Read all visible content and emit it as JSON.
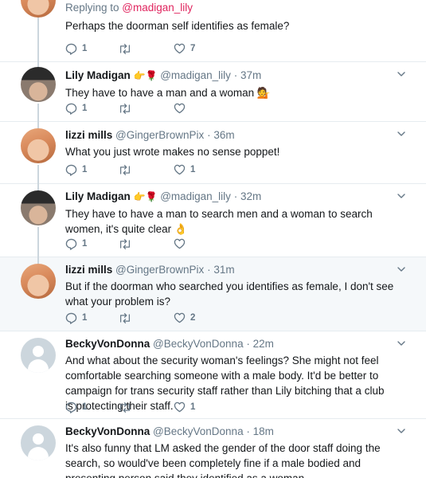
{
  "thread": {
    "replying_to_prefix": "Replying to ",
    "replying_to_handle": "@madigan_lily"
  },
  "tweets": [
    {
      "text": "Perhaps the doorman self identifies as female?",
      "replies": "1",
      "retweets": "",
      "likes": "7"
    },
    {
      "name": "Lily Madigan",
      "badges": "👉🌹",
      "handle": "@madigan_lily",
      "sep": "·",
      "time": "37m",
      "text": "They have to have a man and a woman 💁",
      "replies": "1",
      "retweets": "",
      "likes": ""
    },
    {
      "name": "lizzi mills",
      "handle": "@GingerBrownPix",
      "sep": "·",
      "time": "36m",
      "text": "What you just wrote makes no sense poppet!",
      "replies": "1",
      "retweets": "",
      "likes": "1"
    },
    {
      "name": "Lily Madigan",
      "badges": "👉🌹",
      "handle": "@madigan_lily",
      "sep": "·",
      "time": "32m",
      "text": "They have to have a man to search men and a woman to search women, it's quite clear 👌",
      "replies": "1",
      "retweets": "",
      "likes": ""
    },
    {
      "name": "lizzi mills",
      "handle": "@GingerBrownPix",
      "sep": "·",
      "time": "31m",
      "text": "But if the doorman who searched you identifies as female, I don't see what your problem is?",
      "replies": "1",
      "retweets": "",
      "likes": "2"
    },
    {
      "name": "BeckyVonDonna",
      "handle": "@BeckyVonDonna",
      "sep": "·",
      "time": "22m",
      "text": "And what about the security woman's feelings? She might not feel comfortable searching someone with a male body. It'd be better to campaign for trans security staff rather than Lily bitching that a club is protecting their staff.",
      "replies": "1",
      "retweets": "",
      "likes": "1"
    },
    {
      "name": "BeckyVonDonna",
      "handle": "@BeckyVonDonna",
      "sep": "·",
      "time": "18m",
      "text": "It's also funny that LM asked the gender of the door staff doing the search, so would've been completely fine if a male bodied and presenting person said they identified as a woman.",
      "replies": "",
      "retweets": "",
      "likes": ""
    }
  ],
  "colors": {
    "text": "#14171a",
    "secondary": "#657786",
    "mention": "#e0245e",
    "thread_line": "#ccd6dd",
    "highlight_bg": "#f5f8fa",
    "divider": "#e6ecf0"
  },
  "icons": {
    "reply": "reply-icon",
    "retweet": "retweet-icon",
    "like": "heart-icon",
    "more": "chevron-down-icon",
    "default_avatar": "default-avatar-icon"
  }
}
